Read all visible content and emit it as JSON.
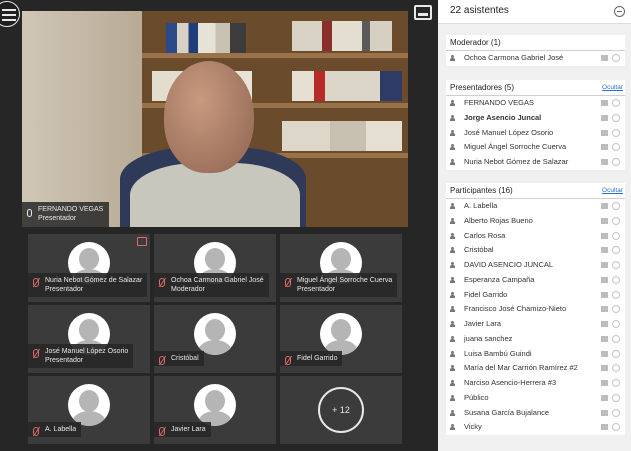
{
  "main_video": {
    "speaker_name": "FERNANDO VEGAS",
    "speaker_role": "Presentador"
  },
  "tiles": [
    {
      "name": "Nuria Nebot Gómez de Salazar",
      "role": "Presentador"
    },
    {
      "name": "Ochoa Carmona Gabriel José",
      "role": "Moderador"
    },
    {
      "name": "Miguel Ángel Sorroche Cuerva",
      "role": "Presentador"
    },
    {
      "name": "José Manuel López Osorio",
      "role": "Presentador"
    },
    {
      "name": "Cristóbal",
      "role": ""
    },
    {
      "name": "Fidel Garrido",
      "role": ""
    },
    {
      "name": "A. Labella",
      "role": ""
    },
    {
      "name": "Javier Lara",
      "role": ""
    }
  ],
  "more_count": "+ 12",
  "panel": {
    "title": "22 asistentes",
    "moderator": {
      "title": "Moderador (1)",
      "items": [
        "Ochoa Carmona Gabriel José"
      ]
    },
    "presenters": {
      "title": "Presentadores (5)",
      "hide_label": "Ocultar",
      "items": [
        "FERNANDO VEGAS",
        "Jorge Asencio Juncal",
        "José Manuel López Osorio",
        "Miguel Ángel Sorroche Cuerva",
        "Nuria Nebot Gómez de Salazar"
      ]
    },
    "participants": {
      "title": "Participantes (16)",
      "hide_label": "Ocultar",
      "items": [
        "A. Labella",
        "Alberto Rojas Bueno",
        "Carlos Rosa",
        "Cristóbal",
        "DAVID ASENCIO JUNCAL",
        "Esperanza Campaña",
        "Fidel Garrido",
        "Francisco José Chamizo-Nieto",
        "Javier Lara",
        "juana sanchez",
        "Luisa Bambú Guindi",
        "María del Mar Carrión Ramírez #2",
        "Narciso Asencio-Herrera #3",
        "Público",
        "Susana García Bujalance",
        "Vicky"
      ]
    }
  },
  "colors": {
    "stage_bg": "#262626",
    "tile_bg": "#3b3b3b",
    "link": "#2a6fcf",
    "muted": "#e06a6a"
  }
}
